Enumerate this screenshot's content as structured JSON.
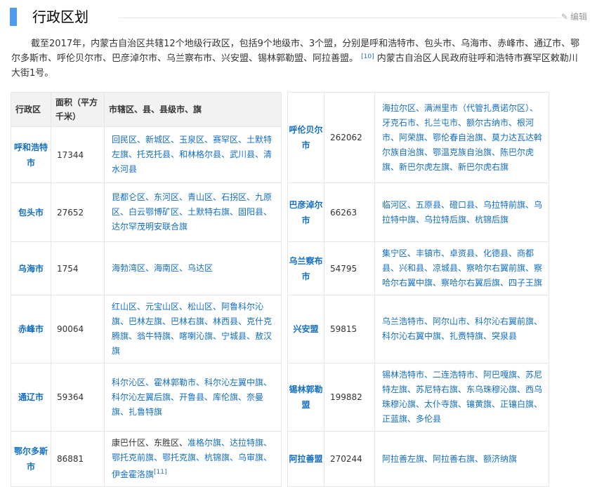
{
  "header": {
    "title": "行政区划",
    "edit_label": "编辑"
  },
  "intro": {
    "text": "截至2017年，内蒙古自治区共辖12个地级行政区，包括9个地级市、3个盟，分别是呼和浩特市、包头市、乌海市、赤峰市、通辽市、鄂尔多斯市、呼伦贝尔市、巴彦淖尔市、乌兰察布市、兴安盟、锡林郭勒盟、阿拉善盟。",
    "ref": "[10]",
    "text2": "内蒙古自治区人民政府驻呼和浩特市赛罕区敕勒川大街1号。"
  },
  "table": {
    "headers": [
      "行政区",
      "面积（平方千米）",
      "市辖区、县、县级市、旗"
    ],
    "rows": [
      {
        "left": {
          "name": "呼和浩特市",
          "area": "17344",
          "districts": "回民区、新城区、玉泉区、赛罕区、土默特左旗、托克托县、和林格尔县、武川县、清水河县"
        },
        "right": {
          "name": "呼伦贝尔市",
          "area": "262062",
          "districts": "海拉尔区、满洲里市（代管扎赉诺尔区）、牙克石市、扎兰屯市、额尔古纳市、根河市、阿荣旗、鄂伦春自治旗、莫力达瓦达斡尔族自治旗、鄂温克族自治旗、陈巴尔虎旗、新巴尔虎左旗、新巴尔虎右旗"
        }
      },
      {
        "left": {
          "name": "包头市",
          "area": "27652",
          "districts": "昆都仑区、东河区、青山区、石拐区、九原区、白云鄂博矿区、土默特右旗、固阳县、达尔罕茂明安联合旗"
        },
        "right": {
          "name": "巴彦淖尔市",
          "area": "66263",
          "districts": "临河区、五原县、磴口县、乌拉特前旗、乌拉特中旗、乌拉特后旗、杭锦后旗"
        }
      },
      {
        "left": {
          "name": "乌海市",
          "area": "1754",
          "districts": "海勃湾区、海南区、乌达区"
        },
        "right": {
          "name": "乌兰察布市",
          "area": "54795",
          "districts": "集宁区、丰镇市、卓资县、化德县、商都县、兴和县、凉城县、察哈尔右翼前旗、察哈尔右翼中旗、察哈尔右翼后旗、四子王旗"
        }
      },
      {
        "left": {
          "name": "赤峰市",
          "area": "90064",
          "districts": "红山区、元宝山区、松山区、阿鲁科尔沁旗、巴林左旗、巴林右旗、林西县、克什克腾旗、翁牛特旗、喀喇沁旗、宁城县、敖汉旗"
        },
        "right": {
          "name": "兴安盟",
          "area": "59815",
          "districts": "乌兰浩特市、阿尔山市、科尔沁右翼前旗、科尔沁右翼中旗、扎赉特旗、突泉县"
        }
      },
      {
        "left": {
          "name": "通辽市",
          "area": "59364",
          "districts": "科尔沁区、霍林郭勒市、科尔沁左翼中旗、科尔沁左翼后旗、开鲁县、库伦旗、奈曼旗、扎鲁特旗"
        },
        "right": {
          "name": "锡林郭勒盟",
          "area": "199882",
          "districts": "锡林浩特市、二连浩特市、阿巴嘎旗、苏尼特左旗、苏尼特右旗、东乌珠穆沁旗、西乌珠穆沁旗、太仆寺旗、镶黄旗、正镶白旗、正蓝旗、多伦县"
        }
      },
      {
        "left": {
          "name": "鄂尔多斯市",
          "area": "86881",
          "districts_plain": "康巴什区、东胜区、",
          "districts": "准格尔旗、达拉特旗、鄂托克前旗、鄂托克旗、杭锦旗、乌审旗、伊金霍洛旗",
          "ref": "[11]"
        },
        "right": {
          "name": "阿拉善盟",
          "area": "270244",
          "districts": "阿拉善左旗、阿拉善右旗、额济纳旗"
        }
      }
    ]
  },
  "colors": {
    "accent": "#4f9cee",
    "link": "#136ec2"
  },
  "icons": {
    "edit": "pencil-icon"
  }
}
